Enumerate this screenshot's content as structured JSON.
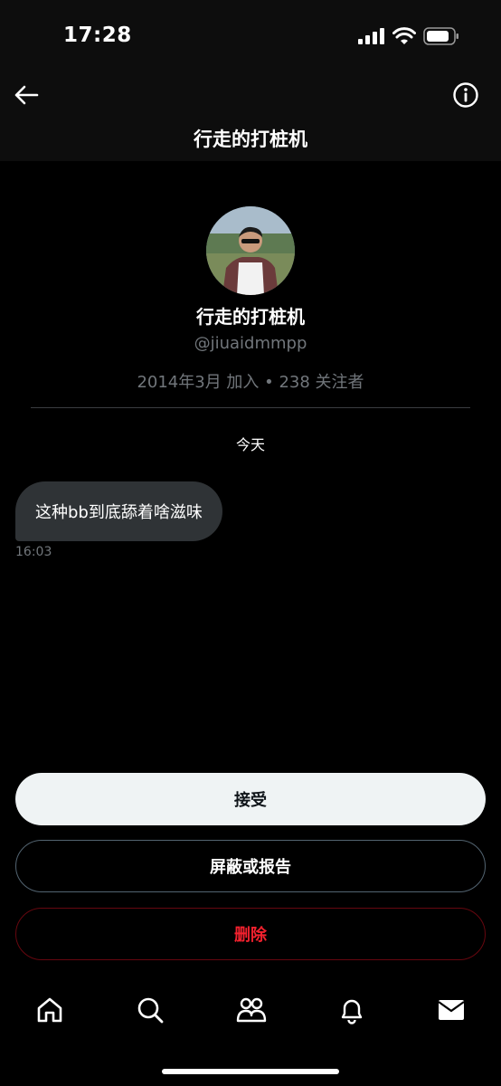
{
  "status_bar": {
    "time": "17:28",
    "icons": [
      "signal-icon",
      "wifi-icon",
      "battery-icon"
    ]
  },
  "header": {
    "title": "行走的打桩机",
    "back_icon": "arrow-left-icon",
    "info_icon": "info-icon"
  },
  "profile": {
    "name": "行走的打桩机",
    "handle": "@jiuaidmmpp",
    "meta": "2014年3月 加入 • 238 关注者"
  },
  "conversation": {
    "day_label": "今天",
    "messages": [
      {
        "text": "这种bb到底舔着啥滋味",
        "time": "16:03"
      }
    ]
  },
  "actions": {
    "accept_label": "接受",
    "block_label": "屏蔽或报告",
    "delete_label": "删除"
  },
  "bottom_nav": {
    "items": [
      "home-icon",
      "search-icon",
      "communities-icon",
      "notifications-icon",
      "messages-icon"
    ],
    "active": "messages-icon"
  },
  "colors": {
    "background": "#000000",
    "bubble": "#2f3336",
    "secondary_text": "#71767b",
    "delete_red": "#f4212e",
    "accept_bg": "#eff3f4"
  }
}
